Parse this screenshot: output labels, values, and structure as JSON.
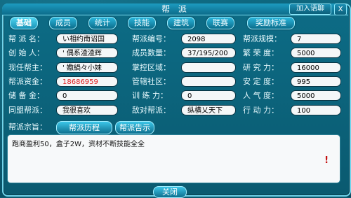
{
  "window": {
    "title": "帮 派",
    "join_label": "加入语聊",
    "close_label": "X"
  },
  "tabs": [
    {
      "label": "基础",
      "active": true
    },
    {
      "label": "成员"
    },
    {
      "label": "统计"
    },
    {
      "label": "技能"
    },
    {
      "label": "建筑"
    },
    {
      "label": "联赛"
    },
    {
      "label": "奖励标准"
    }
  ],
  "info": {
    "gang_name_label": "帮 派 名：",
    "gang_name": "い相约南诏国",
    "gang_id_label": "帮派编号：",
    "gang_id": "2098",
    "gang_scale_label": "帮派规模：",
    "gang_scale": "7",
    "founder_label": "创 始 人：",
    "founder": "' 偶系渣渣辉",
    "members_label": "成员数量：",
    "members": "37/195/200",
    "prosperity_label": "繁 荣 度：",
    "prosperity": "5000",
    "leader_label": "现任帮主：",
    "leader": "' 嫐緺々小妹",
    "territory_label": "掌控区域：",
    "territory": "",
    "research_label": "研 究 力：",
    "research": "16000",
    "funds_label": "帮派资金：",
    "funds": "18686959",
    "community_label": "管辖社区：",
    "community": "",
    "stability_label": "安 定 度：",
    "stability": "995",
    "reserve_label": "储 备 金：",
    "reserve": "0",
    "training_label": "训 练 力：",
    "training": "0",
    "popularity_label": "人 气 度：",
    "popularity": "5000",
    "ally_label": "同盟帮派：",
    "ally": "我很喜欢",
    "enemy_label": "敌对帮派：",
    "enemy": "纵横乂天下",
    "action_label": "行 动 力：",
    "action": "100"
  },
  "purpose": {
    "label": "帮派宗旨：",
    "history_button": "帮派历程",
    "notice_button": "帮派告示"
  },
  "notice_text": "跑商盈利50，盒子2W，资材不断技能全全",
  "notice_mark": "!",
  "footer": {
    "close_button": "关闭"
  }
}
